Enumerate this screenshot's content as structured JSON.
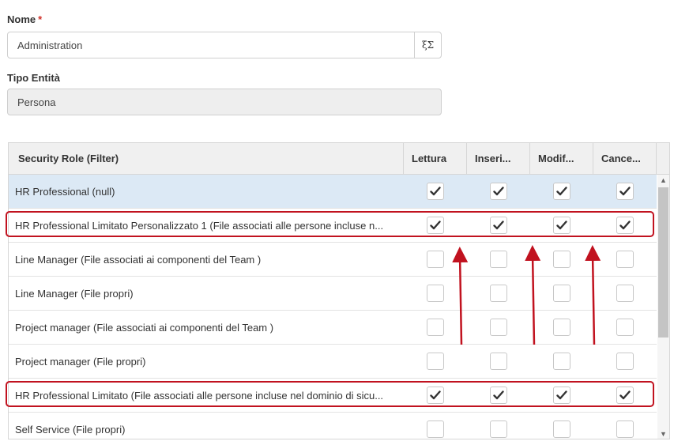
{
  "form": {
    "name_label": "Nome",
    "required_mark": "*",
    "name_value": "Administration",
    "expression_icon": "ξΣ",
    "entity_type_label": "Tipo Entità",
    "entity_type_value": "Persona"
  },
  "grid": {
    "columns": [
      "Security Role (Filter)",
      "Lettura",
      "Inseri...",
      "Modif...",
      "Cance..."
    ],
    "rows": [
      {
        "name": "HR Professional (null)",
        "checks": [
          true,
          true,
          true,
          true
        ],
        "selected": true,
        "highlighted": false
      },
      {
        "name": "HR Professional Limitato Personalizzato 1 (File associati alle persone incluse n...",
        "checks": [
          true,
          true,
          true,
          true
        ],
        "selected": false,
        "highlighted": true
      },
      {
        "name": "Line Manager (File associati ai componenti del Team )",
        "checks": [
          false,
          false,
          false,
          false
        ],
        "selected": false,
        "highlighted": false
      },
      {
        "name": "Line Manager (File propri)",
        "checks": [
          false,
          false,
          false,
          false
        ],
        "selected": false,
        "highlighted": false
      },
      {
        "name": "Project manager (File associati ai componenti del Team )",
        "checks": [
          false,
          false,
          false,
          false
        ],
        "selected": false,
        "highlighted": false
      },
      {
        "name": "Project manager (File propri)",
        "checks": [
          false,
          false,
          false,
          false
        ],
        "selected": false,
        "highlighted": false
      },
      {
        "name": "HR Professional Limitato (File associati alle persone incluse nel dominio di sicu...",
        "checks": [
          true,
          true,
          true,
          true
        ],
        "selected": false,
        "highlighted": true
      },
      {
        "name": "Self Service (File propri)",
        "checks": [
          false,
          false,
          false,
          false
        ],
        "selected": false,
        "highlighted": false
      }
    ]
  },
  "colors": {
    "highlight": "#c1121f",
    "selected_row": "#dce9f5"
  }
}
